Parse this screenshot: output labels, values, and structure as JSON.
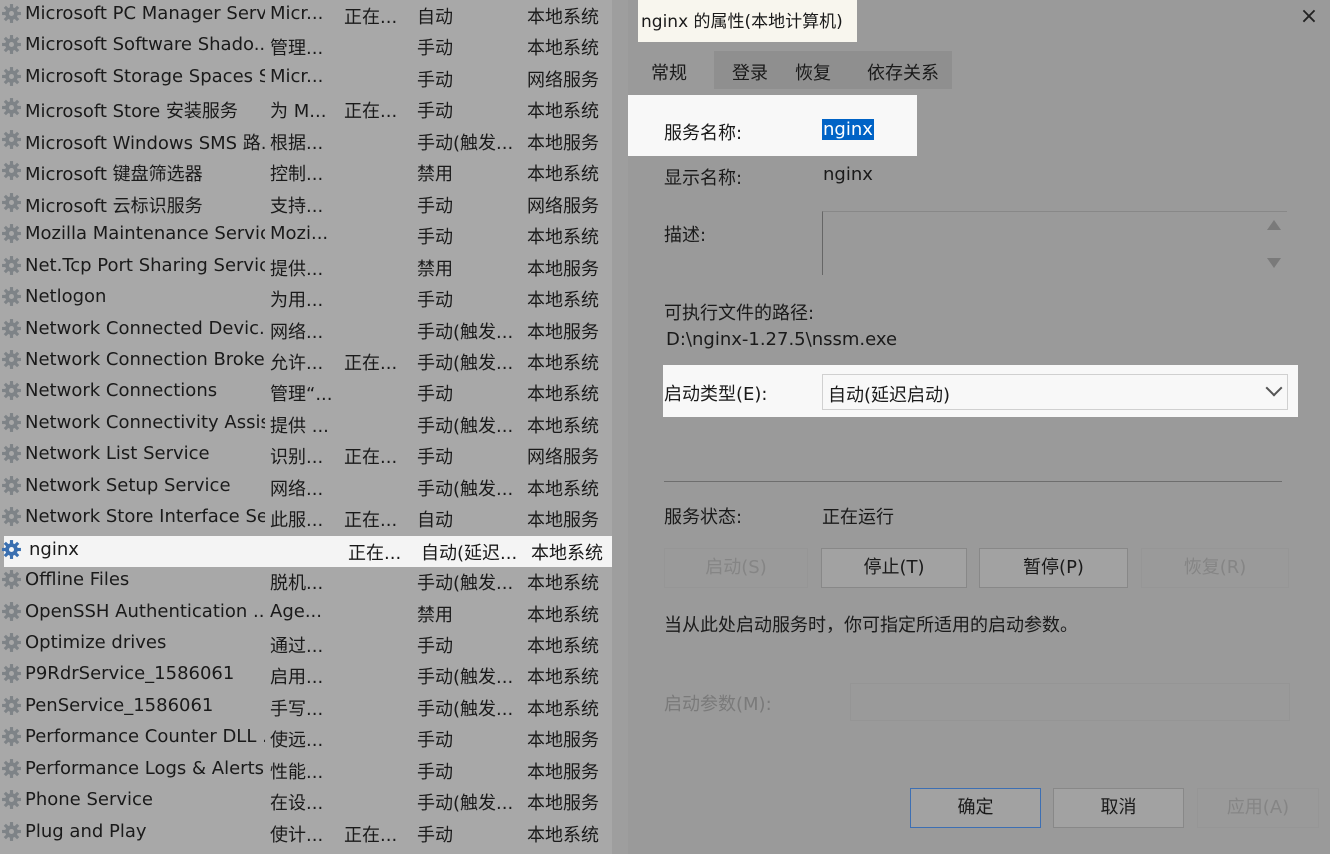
{
  "services": [
    {
      "name": "Microsoft PC Manager Serv...",
      "desc": "Micr...",
      "status": "正在...",
      "startup": "自动",
      "logon": "本地系统"
    },
    {
      "name": "Microsoft Software Shado...",
      "desc": "管理...",
      "status": "",
      "startup": "手动",
      "logon": "本地系统"
    },
    {
      "name": "Microsoft Storage Spaces S...",
      "desc": "Micr...",
      "status": "",
      "startup": "手动",
      "logon": "网络服务"
    },
    {
      "name": "Microsoft Store 安装服务",
      "desc": "为 M...",
      "status": "正在...",
      "startup": "手动",
      "logon": "本地系统"
    },
    {
      "name": "Microsoft Windows SMS 路...",
      "desc": "根据...",
      "status": "",
      "startup": "手动(触发...",
      "logon": "本地服务"
    },
    {
      "name": "Microsoft 键盘筛选器",
      "desc": "控制...",
      "status": "",
      "startup": "禁用",
      "logon": "本地系统"
    },
    {
      "name": "Microsoft 云标识服务",
      "desc": "支持...",
      "status": "",
      "startup": "手动",
      "logon": "网络服务"
    },
    {
      "name": "Mozilla Maintenance Service",
      "desc": "Mozi...",
      "status": "",
      "startup": "手动",
      "logon": "本地系统"
    },
    {
      "name": "Net.Tcp Port Sharing Service",
      "desc": "提供...",
      "status": "",
      "startup": "禁用",
      "logon": "本地服务"
    },
    {
      "name": "Netlogon",
      "desc": "为用...",
      "status": "",
      "startup": "手动",
      "logon": "本地系统"
    },
    {
      "name": "Network Connected Devic...",
      "desc": "网络...",
      "status": "",
      "startup": "手动(触发...",
      "logon": "本地服务"
    },
    {
      "name": "Network Connection Broker",
      "desc": "允许...",
      "status": "正在...",
      "startup": "手动(触发...",
      "logon": "本地系统"
    },
    {
      "name": "Network Connections",
      "desc": "管理“...",
      "status": "",
      "startup": "手动",
      "logon": "本地系统"
    },
    {
      "name": "Network Connectivity Assis...",
      "desc": "提供 ...",
      "status": "",
      "startup": "手动(触发...",
      "logon": "本地系统"
    },
    {
      "name": "Network List Service",
      "desc": "识别...",
      "status": "正在...",
      "startup": "手动",
      "logon": "网络服务"
    },
    {
      "name": "Network Setup Service",
      "desc": "网络...",
      "status": "",
      "startup": "手动(触发...",
      "logon": "本地系统"
    },
    {
      "name": "Network Store Interface Se...",
      "desc": "此服...",
      "status": "正在...",
      "startup": "自动",
      "logon": "本地服务"
    },
    {
      "name": "nginx",
      "desc": "",
      "status": "正在...",
      "startup": "自动(延迟...",
      "logon": "本地系统",
      "selected": true
    },
    {
      "name": "Offline Files",
      "desc": "脱机...",
      "status": "",
      "startup": "手动(触发...",
      "logon": "本地系统"
    },
    {
      "name": "OpenSSH Authentication ...",
      "desc": "Age...",
      "status": "",
      "startup": "禁用",
      "logon": "本地系统"
    },
    {
      "name": "Optimize drives",
      "desc": "通过...",
      "status": "",
      "startup": "手动",
      "logon": "本地系统"
    },
    {
      "name": "P9RdrService_1586061",
      "desc": "启用...",
      "status": "",
      "startup": "手动(触发...",
      "logon": "本地系统"
    },
    {
      "name": "PenService_1586061",
      "desc": "手写...",
      "status": "",
      "startup": "手动(触发...",
      "logon": "本地系统"
    },
    {
      "name": "Performance Counter DLL ...",
      "desc": "使远...",
      "status": "",
      "startup": "手动",
      "logon": "本地服务"
    },
    {
      "name": "Performance Logs & Alerts",
      "desc": "性能...",
      "status": "",
      "startup": "手动",
      "logon": "本地服务"
    },
    {
      "name": "Phone Service",
      "desc": "在设...",
      "status": "",
      "startup": "手动(触发...",
      "logon": "本地服务"
    },
    {
      "name": "Plug and Play",
      "desc": "使计...",
      "status": "正在...",
      "startup": "手动",
      "logon": "本地系统"
    }
  ],
  "dialog": {
    "title": "nginx 的属性(本地计算机)",
    "close_icon": "×",
    "tabs": [
      "常规",
      "登录",
      "恢复",
      "依存关系"
    ],
    "service_name_label": "服务名称:",
    "service_name_value": "nginx",
    "display_name_label": "显示名称:",
    "display_name_value": "nginx",
    "description_label": "描述:",
    "path_label": "可执行文件的路径:",
    "path_value": "D:\\nginx-1.27.5\\nssm.exe",
    "startup_type_label": "启动类型(E):",
    "startup_type_value": "自动(延迟启动)",
    "service_status_label": "服务状态:",
    "service_status_value": "正在运行",
    "buttons": {
      "start": "启动(S)",
      "stop": "停止(T)",
      "pause": "暂停(P)",
      "resume": "恢复(R)"
    },
    "hint": "当从此处启动服务时，你可指定所适用的启动参数。",
    "param_label": "启动参数(M):",
    "ok": "确定",
    "cancel": "取消",
    "apply": "应用(A)"
  }
}
